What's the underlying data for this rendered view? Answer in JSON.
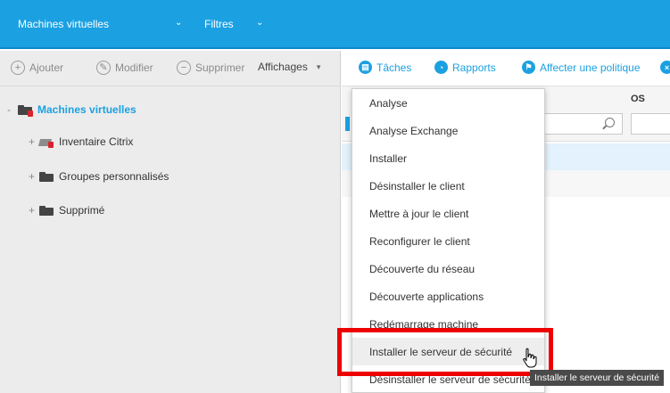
{
  "topbar": {
    "title": "Machines virtuelles",
    "filters": "Filtres",
    "chevron": "⌄"
  },
  "left_toolbar": {
    "add": "Ajouter",
    "edit": "Modifier",
    "delete": "Supprimer",
    "views": "Affichages"
  },
  "tree": {
    "root": "Machines virtuelles",
    "items": [
      {
        "toggle": "+",
        "label": "Inventaire Citrix"
      },
      {
        "toggle": "+",
        "label": "Groupes personnalisés"
      },
      {
        "toggle": "+",
        "label": "Supprimé"
      }
    ],
    "root_toggle": "-"
  },
  "right_toolbar": {
    "tasks": "Tâches",
    "reports": "Rapports",
    "assign_policy": "Affecter une politique"
  },
  "grid": {
    "os_header": "OS"
  },
  "menu": {
    "items": [
      "Analyse",
      "Analyse Exchange",
      "Installer",
      "Désinstaller le client",
      "Mettre à jour le client",
      "Reconfigurer le client",
      "Découverte du réseau",
      "Découverte applications",
      "Redémarrage machine",
      "Installer le serveur de sécurité",
      "Désinstaller le serveur de sécurité"
    ],
    "hovered_index": 9
  },
  "tooltip": "Installer le serveur de sécurité",
  "colors": {
    "accent": "#1ba1e2",
    "highlight": "#ee0000",
    "badge": "#d9232d"
  }
}
